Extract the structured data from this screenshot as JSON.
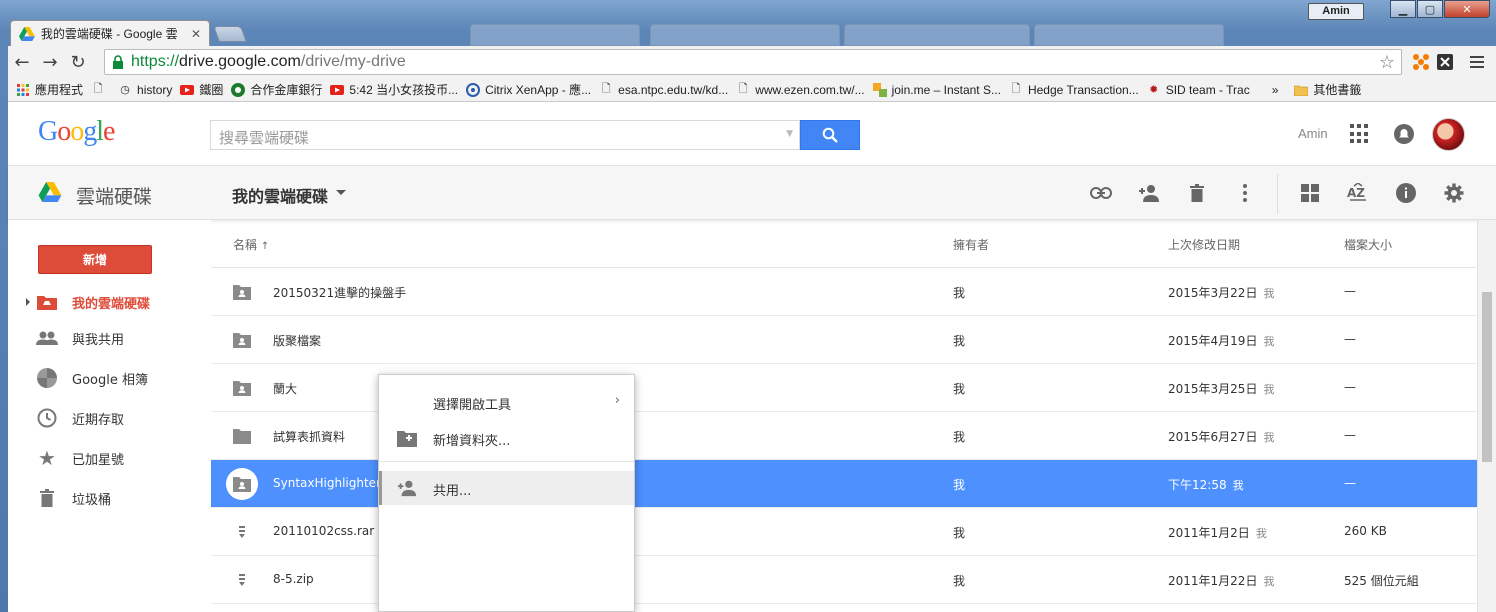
{
  "window": {
    "user_label": "Amin"
  },
  "browser": {
    "active_tab_title": "我的雲端硬碟 - Google 雲",
    "url_scheme": "https://",
    "url_host": "drive.google.com",
    "url_path": "/drive/my-drive",
    "bookmarks": [
      {
        "label": "應用程式",
        "icon": "apps-icon"
      },
      {
        "label": "",
        "icon": "page-icon"
      },
      {
        "label": "history",
        "icon": "clock-icon"
      },
      {
        "label": "鐵圈",
        "icon": "youtube-icon"
      },
      {
        "label": "合作金庫銀行",
        "icon": "bank-icon"
      },
      {
        "label": "5:42 当小女孩投币...",
        "icon": "youtube-icon"
      },
      {
        "label": "Citrix XenApp - 應...",
        "icon": "citrix-icon"
      },
      {
        "label": "esa.ntpc.edu.tw/kd...",
        "icon": "page-icon"
      },
      {
        "label": "www.ezen.com.tw/...",
        "icon": "page-icon"
      },
      {
        "label": "join.me – Instant S...",
        "icon": "joinme-icon"
      },
      {
        "label": "Hedge Transaction...",
        "icon": "page-icon"
      },
      {
        "label": "SID team - Trac",
        "icon": "trac-icon"
      }
    ],
    "bookmarks_overflow": "»",
    "other_bookmarks": "其他書籤"
  },
  "drive": {
    "search_placeholder": "搜尋雲端硬碟",
    "account_name": "Amin",
    "app_name": "雲端硬碟",
    "breadcrumb": "我的雲端硬碟",
    "new_button": "新增",
    "nav": [
      {
        "label": "我的雲端硬碟",
        "icon": "drive-folder-icon",
        "active": true
      },
      {
        "label": "與我共用",
        "icon": "people-icon",
        "active": false
      },
      {
        "label": "Google 相簿",
        "icon": "photos-icon",
        "active": false
      },
      {
        "label": "近期存取",
        "icon": "clock-icon",
        "active": false
      },
      {
        "label": "已加星號",
        "icon": "star-icon",
        "active": false
      },
      {
        "label": "垃圾桶",
        "icon": "trash-icon",
        "active": false
      }
    ],
    "columns": {
      "name": "名稱",
      "sort": "↑",
      "owner": "擁有者",
      "modified": "上次修改日期",
      "size": "檔案大小"
    },
    "files": [
      {
        "name": "20150321進擊的操盤手",
        "type": "shared-folder",
        "owner": "我",
        "modified": "2015年3月22日",
        "modified_by": "我",
        "size": "—"
      },
      {
        "name": "版聚檔案",
        "type": "shared-folder",
        "owner": "我",
        "modified": "2015年4月19日",
        "modified_by": "我",
        "size": "—"
      },
      {
        "name": "蘭大",
        "type": "shared-folder",
        "owner": "我",
        "modified": "2015年3月25日",
        "modified_by": "我",
        "size": "—"
      },
      {
        "name": "試算表抓資料",
        "type": "folder",
        "owner": "我",
        "modified": "2015年6月27日",
        "modified_by": "我",
        "size": "—"
      },
      {
        "name": "SyntaxHighlighter",
        "type": "shared-folder",
        "owner": "我",
        "modified": "下午12:58",
        "modified_by": "我",
        "size": "—",
        "selected": true
      },
      {
        "name": "20110102css.rar",
        "type": "archive",
        "owner": "我",
        "modified": "2011年1月2日",
        "modified_by": "我",
        "size": "260 KB"
      },
      {
        "name": "8-5.zip",
        "type": "archive",
        "owner": "我",
        "modified": "2011年1月22日",
        "modified_by": "我",
        "size": "525 個位元組"
      }
    ],
    "context_menu": [
      {
        "label": "選擇開啟工具",
        "icon": "",
        "submenu": true
      },
      {
        "label": "新增資料夾...",
        "icon": "new-folder-icon",
        "submenu": false
      },
      {
        "label": "共用...",
        "icon": "share-person-icon",
        "submenu": false,
        "hover": true
      }
    ]
  },
  "colors": {
    "accent_red": "#dd4b39",
    "selection_blue": "#4d90fe",
    "search_blue": "#4285f4"
  }
}
